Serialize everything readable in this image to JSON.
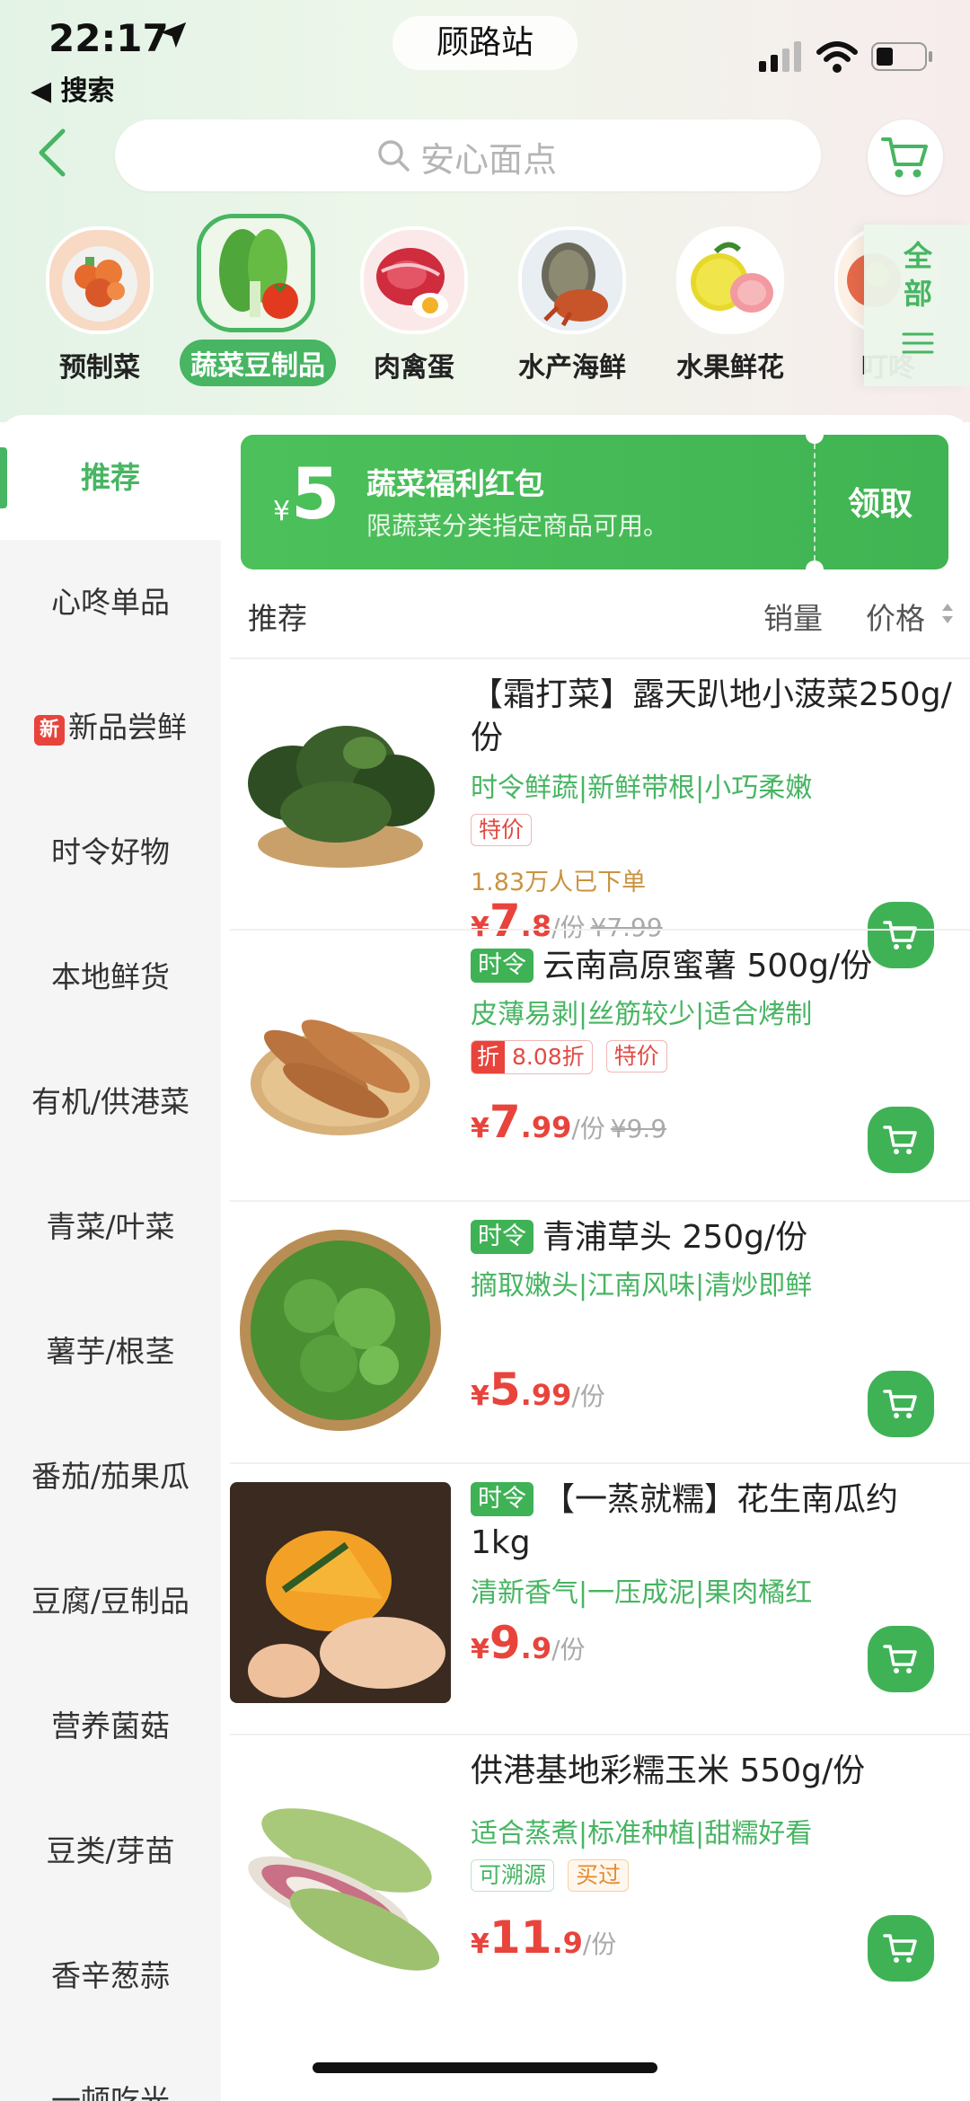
{
  "status_bar": {
    "time": "22:17",
    "back_label": "◀ 搜索",
    "station": "顾路站"
  },
  "search": {
    "placeholder": "安心面点"
  },
  "categories": [
    {
      "label": "预制菜",
      "active": false
    },
    {
      "label": "蔬菜豆制品",
      "active": true
    },
    {
      "label": "肉禽蛋",
      "active": false
    },
    {
      "label": "水产海鲜",
      "active": false
    },
    {
      "label": "水果鲜花",
      "active": false
    },
    {
      "label": "叮咚",
      "active": false
    }
  ],
  "all_categories": {
    "line1": "全",
    "line2": "部"
  },
  "sidebar": {
    "items": [
      {
        "label": "推荐"
      },
      {
        "label": "心咚单品"
      },
      {
        "label": "新品尝鲜",
        "badge": "新"
      },
      {
        "label": "时令好物"
      },
      {
        "label": "本地鲜货"
      },
      {
        "label": "有机/供港菜"
      },
      {
        "label": "青菜/叶菜"
      },
      {
        "label": "薯芋/根茎"
      },
      {
        "label": "番茄/茄果瓜"
      },
      {
        "label": "豆腐/豆制品"
      },
      {
        "label": "营养菌菇"
      },
      {
        "label": "豆类/芽苗"
      },
      {
        "label": "香辛葱蒜"
      },
      {
        "label": "一顿吃光"
      }
    ]
  },
  "coupon": {
    "yen": "¥",
    "amount": "5",
    "title": "蔬菜福利红包",
    "desc": "限蔬菜分类指定商品可用。",
    "claim": "领取"
  },
  "sort": {
    "recommend": "推荐",
    "sales": "销量",
    "price": "价格"
  },
  "products": [
    {
      "name": "【霜打菜】露天趴地小菠菜250g/份",
      "subtitle": "时令鲜蔬|新鲜带根|小巧柔嫩",
      "tag": "特价",
      "sold": "1.83万人已下单",
      "price_int": "7",
      "price_dec": ".8",
      "unit": "/份",
      "orig": "¥7.99"
    },
    {
      "season": "时令",
      "name": "云南高原蜜薯 500g/份",
      "subtitle": "皮薄易剥|丝筋较少|适合烤制",
      "discount_z": "折",
      "discount_v": "8.08折",
      "tag": "特价",
      "price_int": "7",
      "price_dec": ".99",
      "unit": "/份",
      "orig": "¥9.9"
    },
    {
      "season": "时令",
      "name": "青浦草头 250g/份",
      "subtitle": "摘取嫩头|江南风味|清炒即鲜",
      "price_int": "5",
      "price_dec": ".99",
      "unit": "/份"
    },
    {
      "season": "时令",
      "name": "【一蒸就糯】花生南瓜约1kg",
      "subtitle": "清新香气|一压成泥|果肉橘红",
      "price_int": "9",
      "price_dec": ".9",
      "unit": "/份"
    },
    {
      "name": "供港基地彩糯玉米 550g/份",
      "subtitle": "适合蒸煮|标准种植|甜糯好看",
      "tag_green": "可溯源",
      "tag_orange": "买过",
      "price_int": "11",
      "price_dec": ".9",
      "unit": "/份"
    }
  ],
  "yen_symbol": "¥",
  "colors": {
    "brand_green": "#47b562",
    "price_red": "#e8443c"
  }
}
